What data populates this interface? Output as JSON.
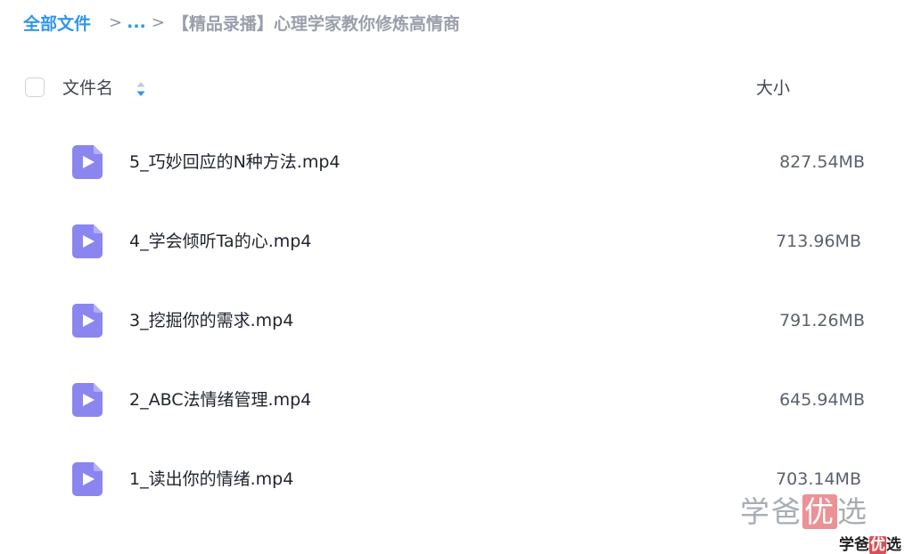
{
  "breadcrumb": {
    "root": "全部文件",
    "sep": ">",
    "ellipsis": "...",
    "current": "【精品录播】心理学家教你修炼高情商"
  },
  "header": {
    "name_label": "文件名",
    "size_label": "大小"
  },
  "files": [
    {
      "name": "5_巧妙回应的N种方法.mp4",
      "size": "827.54MB",
      "icon": "video-file-icon"
    },
    {
      "name": "4_学会倾听Ta的心.mp4",
      "size": "713.96MB",
      "icon": "video-file-icon"
    },
    {
      "name": "3_挖掘你的需求.mp4",
      "size": "791.26MB",
      "icon": "video-file-icon"
    },
    {
      "name": "2_ABC法情绪管理.mp4",
      "size": "645.94MB",
      "icon": "video-file-icon"
    },
    {
      "name": "1_读出你的情绪.mp4",
      "size": "703.14MB",
      "icon": "video-file-icon"
    }
  ],
  "watermark": {
    "large_part1": "学爸",
    "large_highlight": "优",
    "large_part2": "选",
    "small_part1": "学爸",
    "small_highlight": "优",
    "small_part2": "选"
  },
  "colors": {
    "link_blue": "#2e96ea",
    "icon_purple": "#8b86ef",
    "watermark_red": "#e14c54"
  }
}
